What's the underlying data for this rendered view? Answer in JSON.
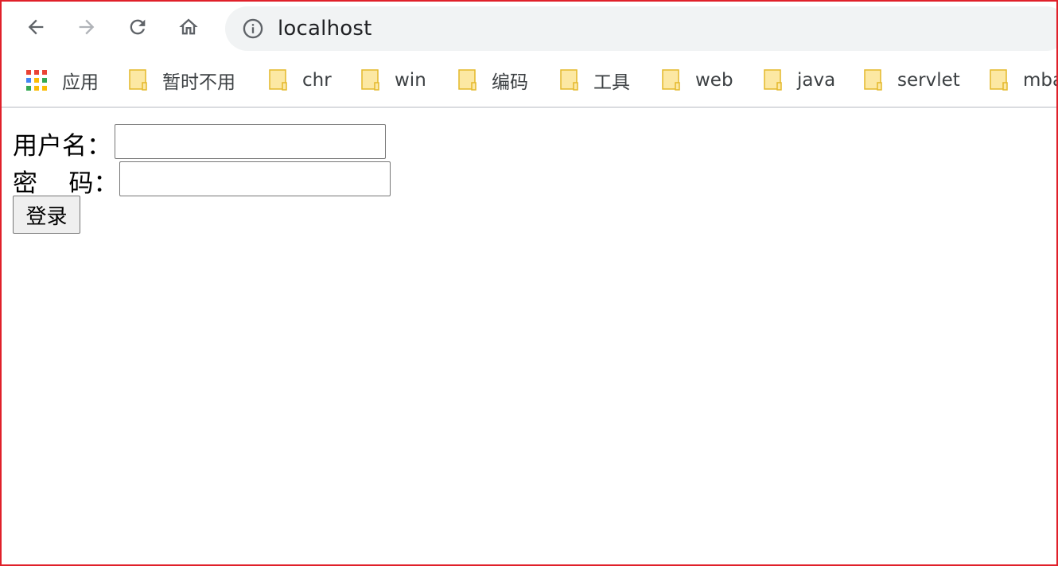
{
  "browser": {
    "url": "localhost",
    "icons": {
      "back": "arrow-left-icon",
      "forward": "arrow-right-icon",
      "reload": "reload-icon",
      "home": "home-icon",
      "site_info": "info-icon"
    }
  },
  "bookmarks": [
    {
      "label": "应用",
      "icon": "apps-grid-icon"
    },
    {
      "label": "暂时不用",
      "icon": "folder-icon"
    },
    {
      "label": "chr",
      "icon": "folder-icon"
    },
    {
      "label": "win",
      "icon": "folder-icon"
    },
    {
      "label": "编码",
      "icon": "folder-icon"
    },
    {
      "label": "工具",
      "icon": "folder-icon"
    },
    {
      "label": "web",
      "icon": "folder-icon"
    },
    {
      "label": "java",
      "icon": "folder-icon"
    },
    {
      "label": "servlet",
      "icon": "folder-icon"
    },
    {
      "label": "mba",
      "icon": "folder-icon"
    }
  ],
  "form": {
    "username_label": "用户名：",
    "username_value": "",
    "password_label": "密    码：",
    "password_value": "",
    "submit_label": "登录"
  },
  "colors": {
    "frame_border": "#e0202a",
    "omnibox_bg": "#f1f3f4",
    "folder_fill": "#fce8a3",
    "folder_stroke": "#e4b82a"
  }
}
